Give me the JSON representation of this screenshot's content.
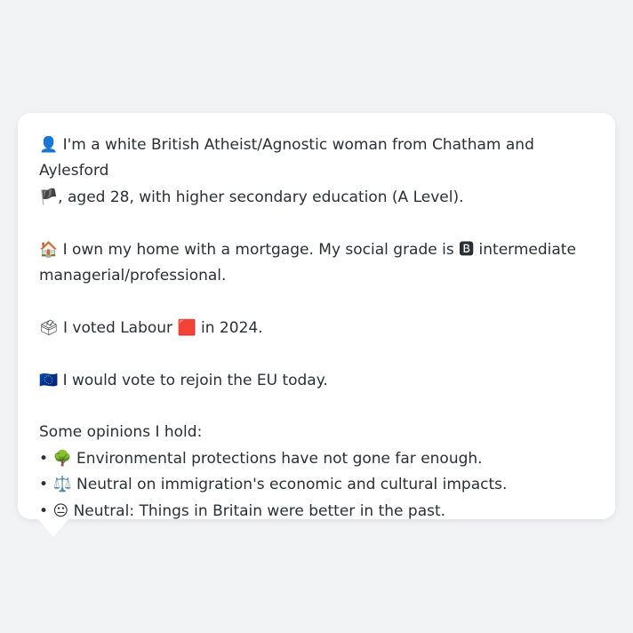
{
  "profile": {
    "identity": {
      "icon": "👤",
      "text": "I'm a white British Atheist/Agnostic woman from Chatham and Aylesford",
      "flag": "🏴",
      "text2": ", aged 28, with higher secondary education (A Level)."
    },
    "home": {
      "icon": "🏠",
      "text": "I own my home with a mortgage. My social grade is",
      "grade_icon": "🅱",
      "text2": "intermediate managerial/professional."
    },
    "vote": {
      "icon": "🗳",
      "text": "I voted Labour",
      "party_icon": "🟥",
      "text2": "in 2024."
    },
    "eu": {
      "icon": "🇪🇺",
      "text": "I would vote to rejoin the EU today."
    },
    "opinions": {
      "heading": "Some opinions I hold:",
      "bullet": "•",
      "items": [
        {
          "icon": "🌳",
          "text": "Environmental protections have not gone far enough."
        },
        {
          "icon": "⚖️",
          "text": "Neutral on immigration's economic and cultural impacts."
        },
        {
          "icon": "😐",
          "text": "Neutral: Things in Britain were better in the past."
        }
      ]
    }
  }
}
